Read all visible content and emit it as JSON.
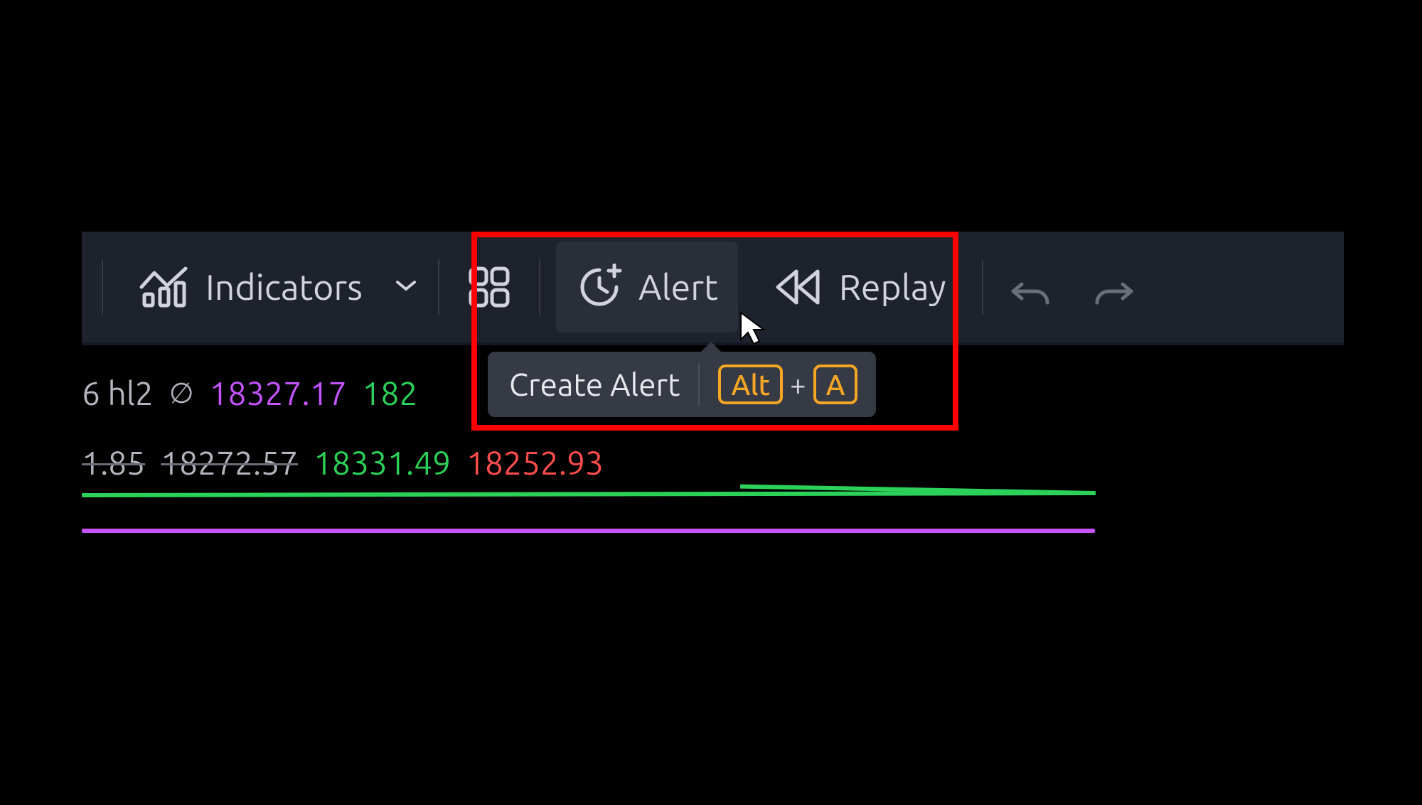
{
  "toolbar": {
    "indicators_label": "Indicators",
    "alert_label": "Alert",
    "replay_label": "Replay"
  },
  "tooltip": {
    "label": "Create Alert",
    "key1": "Alt",
    "plus": "+",
    "key2": "A"
  },
  "row1": {
    "a": "6 hl2",
    "oslash": "∅",
    "purple": "18327.17",
    "green_partial": "182"
  },
  "row2": {
    "v1": "1.85",
    "v2": "18272.57",
    "green": "18331.49",
    "red": "18252.93"
  },
  "colors": {
    "panel": "#1e222d",
    "text": "#d1d4dc",
    "hover": "#2a2e39",
    "tooltip": "#363a45",
    "keyAccent": "#f5a623",
    "green": "#2bd158",
    "purple": "#c554ff",
    "red": "#ff4d4d",
    "highlight": "#ff0000"
  }
}
